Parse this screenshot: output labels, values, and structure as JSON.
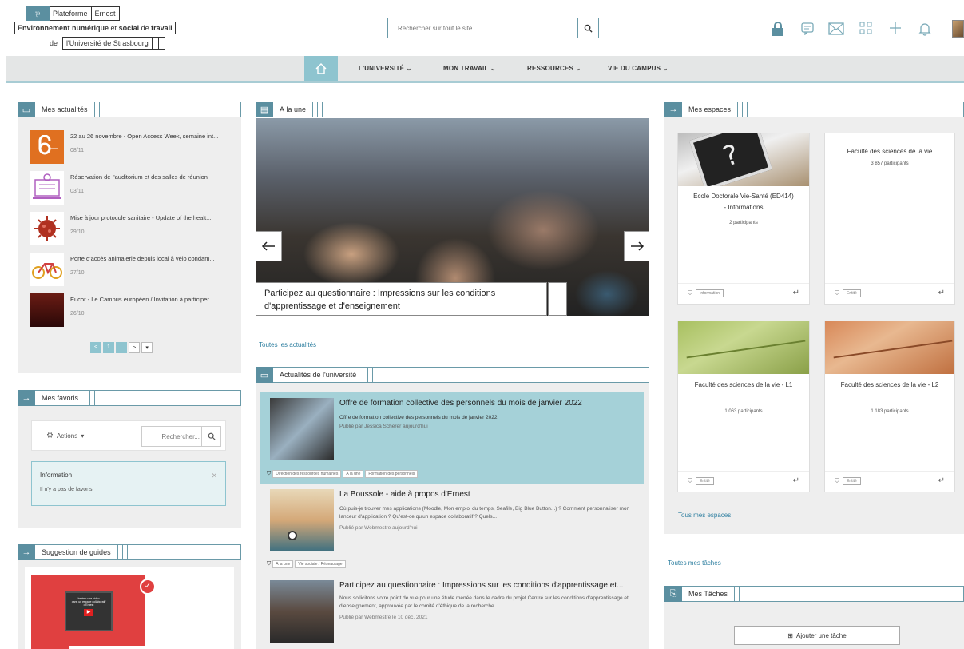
{
  "header": {
    "logo_platform": "Plateforme",
    "logo_name": "Ernest",
    "logo_line2_a": "Environnement numérique",
    "logo_line2_b": "et",
    "logo_line2_c": "social",
    "logo_line2_d": "de",
    "logo_line2_e": "travail",
    "logo_line3_a": "de",
    "logo_line3_b": "l'Université de Strasbourg",
    "search_placeholder": "Rechercher sur tout le site..."
  },
  "nav": {
    "items": [
      {
        "label": "L'UNIVERSITÉ"
      },
      {
        "label": "MON TRAVAIL"
      },
      {
        "label": "RESSOURCES"
      },
      {
        "label": "VIE DU CAMPUS"
      }
    ]
  },
  "left": {
    "actus_title": "Mes actualités",
    "actus": [
      {
        "title": "22 au 26 novembre - Open Access Week, semaine int...",
        "date": "08/11"
      },
      {
        "title": "Réservation de l'auditorium et des salles de réunion",
        "date": "03/11"
      },
      {
        "title": "Mise à jour protocole sanitaire - Update of the healt...",
        "date": "29/10"
      },
      {
        "title": "Porte d'accès animalerie depuis local à vélo condam...",
        "date": "27/10"
      },
      {
        "title": "Eucor - Le Campus européen / Invitation à participer...",
        "date": "26/10"
      }
    ],
    "pager": {
      "prev": "<",
      "p1": "1",
      "dots": "...",
      "next": ">",
      "menu": "▾"
    },
    "favoris_title": "Mes favoris",
    "favoris_actions": "Actions",
    "favoris_search_placeholder": "Rechercher...",
    "favoris_info_title": "Information",
    "favoris_info_text": "Il n'y a pas de favoris.",
    "guides_title": "Suggestion de guides",
    "guide_text_1": "Insérer une vidéo",
    "guide_text_2": "dans un espace collaboratif",
    "guide_text_3": "d'Ernest"
  },
  "center": {
    "une_title": "À la une",
    "carousel_caption": "Participez au questionnaire : Impressions sur les conditions d'apprentissage et d'enseignement",
    "all_news": "Toutes les actualités",
    "uni_title": "Actualités de l'université",
    "uni_items": [
      {
        "title": "Offre de formation collective des personnels du mois de janvier 2022",
        "subtitle": "Offre de formation collective des personnels du mois de janvier 2022",
        "by": "Publié par Jessica Scherer aujourd'hui",
        "tags": [
          "Direction des ressources humaines",
          "A la une",
          "Formation des personnels"
        ]
      },
      {
        "title": "La Boussole - aide à propos d'Ernest",
        "subtitle": "Où puis-je trouver mes applications (Moodle, Mon emploi du temps, Seafile, Big Blue Button...) ? Comment personnaliser mon lanceur d'application ? Qu'est-ce qu'un espace collaboratif ? Quels...",
        "by": "Publié par Webmestre aujourd'hui",
        "tags": [
          "A la une",
          "Vie sociale / Réseautage"
        ]
      },
      {
        "title": "Participez au questionnaire : Impressions sur les conditions d'apprentissage et...",
        "subtitle": "Nous sollicitons votre point de vue pour une étude menée dans le cadre du projet Centré sur les conditions d'apprentissage et d'enseignement, approuvée par le comité d'éthique de la recherche ...",
        "by": "Publié par Webmestre le 10 déc. 2021",
        "tags": []
      }
    ]
  },
  "right": {
    "espaces_title": "Mes espaces",
    "cards": [
      {
        "title": "Ecole Doctorale Vie-Santé (ED414) - Informations",
        "participants": "2 participants",
        "tag": "Information"
      },
      {
        "title": "Faculté des sciences de la vie",
        "participants": "3 857 participants",
        "tag": "Entité"
      },
      {
        "title": "Faculté des sciences de la vie - L1",
        "participants": "1 063 participants",
        "tag": "Entité"
      },
      {
        "title": "Faculté des sciences de la vie - L2",
        "participants": "1 183 participants",
        "tag": "Entité"
      }
    ],
    "all_spaces": "Tous mes espaces",
    "all_tasks": "Toutes mes tâches",
    "taches_title": "Mes Tâches",
    "add_task": "Ajouter une tâche"
  }
}
